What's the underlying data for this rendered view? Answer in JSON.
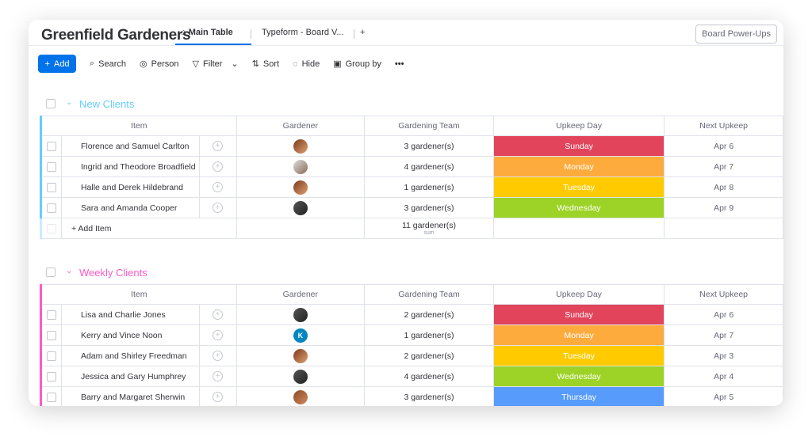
{
  "board": {
    "title": "Greenfield Gardeners",
    "tabs": [
      "Main Table",
      "Typeform - Board V...",
      "+"
    ],
    "power_ups": "Board Power-Ups"
  },
  "toolbar": {
    "add": "Add",
    "search": "Search",
    "person": "Person",
    "filter": "Filter",
    "sort": "Sort",
    "hide": "Hide",
    "group_by": "Group by",
    "more": "•••"
  },
  "columns": [
    "Item",
    "Gardener",
    "Gardening Team",
    "Upkeep Day",
    "Next Upkeep"
  ],
  "status_colors": {
    "Sunday": "#e2445c",
    "Monday": "#fdab3d",
    "Tuesday": "#ffcb00",
    "Wednesday": "#9cd326",
    "Thursday": "#579bfc"
  },
  "groups": [
    {
      "title": "New Clients",
      "color": "#66ccff",
      "add_item": "+ Add Item",
      "sum": "11 gardener(s)",
      "sum_label": "sum",
      "rows": [
        {
          "item": "Florence and Samuel Carlton",
          "gardener": "avatar-1",
          "team": "3 gardener(s)",
          "day": "Sunday",
          "next": "Apr 6"
        },
        {
          "item": "Ingrid and Theodore Broadfield",
          "gardener": "avatar-2",
          "team": "4 gardener(s)",
          "day": "Monday",
          "next": "Apr 7"
        },
        {
          "item": "Halle and Derek Hildebrand",
          "gardener": "avatar-1",
          "team": "1 gardener(s)",
          "day": "Tuesday",
          "next": "Apr 8"
        },
        {
          "item": "Sara and Amanda Cooper",
          "gardener": "avatar-3",
          "team": "3 gardener(s)",
          "day": "Wednesday",
          "next": "Apr 9"
        }
      ]
    },
    {
      "title": "Weekly Clients",
      "color": "#ff5ac4",
      "rows": [
        {
          "item": "Lisa and Charlie Jones",
          "gardener": "avatar-3",
          "team": "2 gardener(s)",
          "day": "Sunday",
          "next": "Apr 6"
        },
        {
          "item": "Kerry and Vince Noon",
          "gardener": "K",
          "team": "1 gardener(s)",
          "day": "Monday",
          "next": "Apr 7"
        },
        {
          "item": "Adam and Shirley Freedman",
          "gardener": "avatar-1",
          "team": "2 gardener(s)",
          "day": "Tuesday",
          "next": "Apr 3"
        },
        {
          "item": "Jessica and Gary Humphrey",
          "gardener": "avatar-3",
          "team": "4 gardener(s)",
          "day": "Wednesday",
          "next": "Apr 4"
        },
        {
          "item": "Barry and Margaret Sherwin",
          "gardener": "avatar-4",
          "team": "3 gardener(s)",
          "day": "Thursday",
          "next": "Apr 5"
        }
      ]
    }
  ]
}
